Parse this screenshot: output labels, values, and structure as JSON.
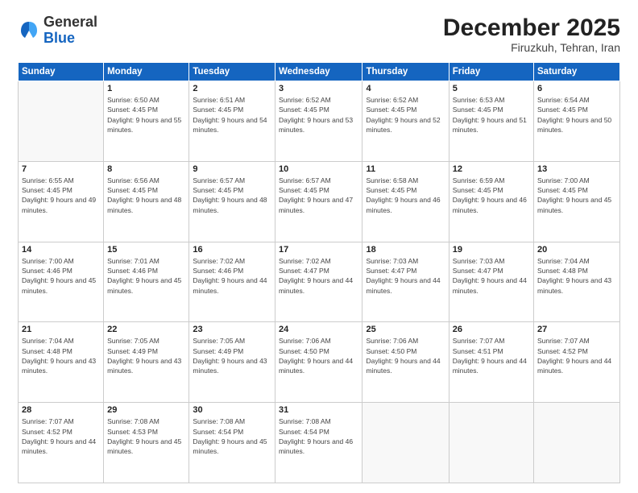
{
  "header": {
    "logo_general": "General",
    "logo_blue": "Blue",
    "month_year": "December 2025",
    "location": "Firuzkuh, Tehran, Iran"
  },
  "days_of_week": [
    "Sunday",
    "Monday",
    "Tuesday",
    "Wednesday",
    "Thursday",
    "Friday",
    "Saturday"
  ],
  "weeks": [
    [
      {
        "num": "",
        "empty": true
      },
      {
        "num": "1",
        "sunrise": "6:50 AM",
        "sunset": "4:45 PM",
        "daylight": "9 hours and 55 minutes."
      },
      {
        "num": "2",
        "sunrise": "6:51 AM",
        "sunset": "4:45 PM",
        "daylight": "9 hours and 54 minutes."
      },
      {
        "num": "3",
        "sunrise": "6:52 AM",
        "sunset": "4:45 PM",
        "daylight": "9 hours and 53 minutes."
      },
      {
        "num": "4",
        "sunrise": "6:52 AM",
        "sunset": "4:45 PM",
        "daylight": "9 hours and 52 minutes."
      },
      {
        "num": "5",
        "sunrise": "6:53 AM",
        "sunset": "4:45 PM",
        "daylight": "9 hours and 51 minutes."
      },
      {
        "num": "6",
        "sunrise": "6:54 AM",
        "sunset": "4:45 PM",
        "daylight": "9 hours and 50 minutes."
      }
    ],
    [
      {
        "num": "7",
        "sunrise": "6:55 AM",
        "sunset": "4:45 PM",
        "daylight": "9 hours and 49 minutes."
      },
      {
        "num": "8",
        "sunrise": "6:56 AM",
        "sunset": "4:45 PM",
        "daylight": "9 hours and 48 minutes."
      },
      {
        "num": "9",
        "sunrise": "6:57 AM",
        "sunset": "4:45 PM",
        "daylight": "9 hours and 48 minutes."
      },
      {
        "num": "10",
        "sunrise": "6:57 AM",
        "sunset": "4:45 PM",
        "daylight": "9 hours and 47 minutes."
      },
      {
        "num": "11",
        "sunrise": "6:58 AM",
        "sunset": "4:45 PM",
        "daylight": "9 hours and 46 minutes."
      },
      {
        "num": "12",
        "sunrise": "6:59 AM",
        "sunset": "4:45 PM",
        "daylight": "9 hours and 46 minutes."
      },
      {
        "num": "13",
        "sunrise": "7:00 AM",
        "sunset": "4:45 PM",
        "daylight": "9 hours and 45 minutes."
      }
    ],
    [
      {
        "num": "14",
        "sunrise": "7:00 AM",
        "sunset": "4:46 PM",
        "daylight": "9 hours and 45 minutes."
      },
      {
        "num": "15",
        "sunrise": "7:01 AM",
        "sunset": "4:46 PM",
        "daylight": "9 hours and 45 minutes."
      },
      {
        "num": "16",
        "sunrise": "7:02 AM",
        "sunset": "4:46 PM",
        "daylight": "9 hours and 44 minutes."
      },
      {
        "num": "17",
        "sunrise": "7:02 AM",
        "sunset": "4:47 PM",
        "daylight": "9 hours and 44 minutes."
      },
      {
        "num": "18",
        "sunrise": "7:03 AM",
        "sunset": "4:47 PM",
        "daylight": "9 hours and 44 minutes."
      },
      {
        "num": "19",
        "sunrise": "7:03 AM",
        "sunset": "4:47 PM",
        "daylight": "9 hours and 44 minutes."
      },
      {
        "num": "20",
        "sunrise": "7:04 AM",
        "sunset": "4:48 PM",
        "daylight": "9 hours and 43 minutes."
      }
    ],
    [
      {
        "num": "21",
        "sunrise": "7:04 AM",
        "sunset": "4:48 PM",
        "daylight": "9 hours and 43 minutes."
      },
      {
        "num": "22",
        "sunrise": "7:05 AM",
        "sunset": "4:49 PM",
        "daylight": "9 hours and 43 minutes."
      },
      {
        "num": "23",
        "sunrise": "7:05 AM",
        "sunset": "4:49 PM",
        "daylight": "9 hours and 43 minutes."
      },
      {
        "num": "24",
        "sunrise": "7:06 AM",
        "sunset": "4:50 PM",
        "daylight": "9 hours and 44 minutes."
      },
      {
        "num": "25",
        "sunrise": "7:06 AM",
        "sunset": "4:50 PM",
        "daylight": "9 hours and 44 minutes."
      },
      {
        "num": "26",
        "sunrise": "7:07 AM",
        "sunset": "4:51 PM",
        "daylight": "9 hours and 44 minutes."
      },
      {
        "num": "27",
        "sunrise": "7:07 AM",
        "sunset": "4:52 PM",
        "daylight": "9 hours and 44 minutes."
      }
    ],
    [
      {
        "num": "28",
        "sunrise": "7:07 AM",
        "sunset": "4:52 PM",
        "daylight": "9 hours and 44 minutes."
      },
      {
        "num": "29",
        "sunrise": "7:08 AM",
        "sunset": "4:53 PM",
        "daylight": "9 hours and 45 minutes."
      },
      {
        "num": "30",
        "sunrise": "7:08 AM",
        "sunset": "4:54 PM",
        "daylight": "9 hours and 45 minutes."
      },
      {
        "num": "31",
        "sunrise": "7:08 AM",
        "sunset": "4:54 PM",
        "daylight": "9 hours and 46 minutes."
      },
      {
        "num": "",
        "empty": true
      },
      {
        "num": "",
        "empty": true
      },
      {
        "num": "",
        "empty": true
      }
    ]
  ]
}
